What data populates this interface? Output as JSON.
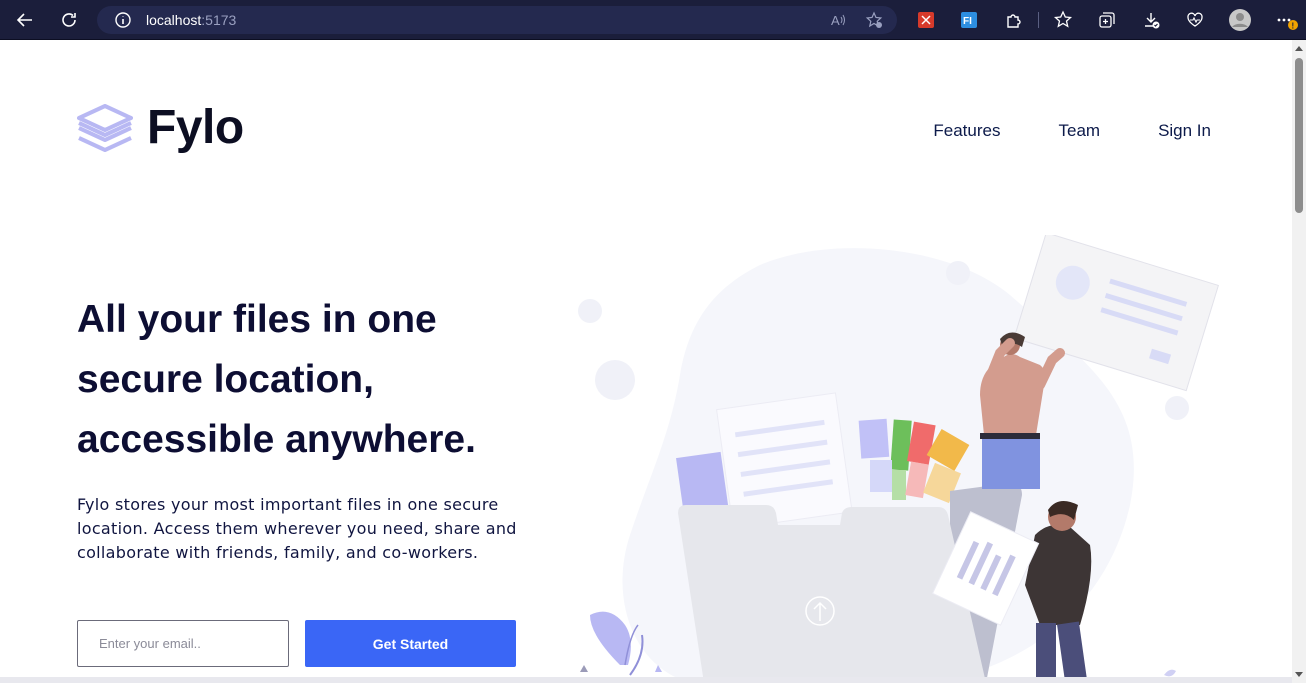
{
  "browser": {
    "url_host": "localhost",
    "url_port": ":5173",
    "notification_badge": "!"
  },
  "brand": {
    "name": "Fylo"
  },
  "nav": {
    "items": [
      {
        "label": "Features"
      },
      {
        "label": "Team"
      },
      {
        "label": "Sign In"
      }
    ]
  },
  "hero": {
    "title": "All your files in one secure location, accessible anywhere.",
    "description": "Fylo stores your most important files in one secure location. Access them wherever you need, share and collaborate with friends, family, and co-workers.",
    "email_placeholder": "Enter your email..",
    "cta_label": "Get Started"
  },
  "colors": {
    "chrome_bg": "#1b1e3b",
    "heading": "#0d0e33",
    "accent": "#3a66f6",
    "logo_icon": "#b8b8f3"
  },
  "icons": {
    "chrome": [
      "back-arrow-icon",
      "refresh-icon",
      "info-icon",
      "read-aloud-icon",
      "add-favorite-icon",
      "extension-red-icon",
      "extension-fi-icon",
      "extensions-puzzle-icon",
      "favorites-icon",
      "collections-icon",
      "downloads-icon",
      "performance-heart-icon",
      "profile-avatar-icon",
      "more-menu-icon"
    ]
  }
}
